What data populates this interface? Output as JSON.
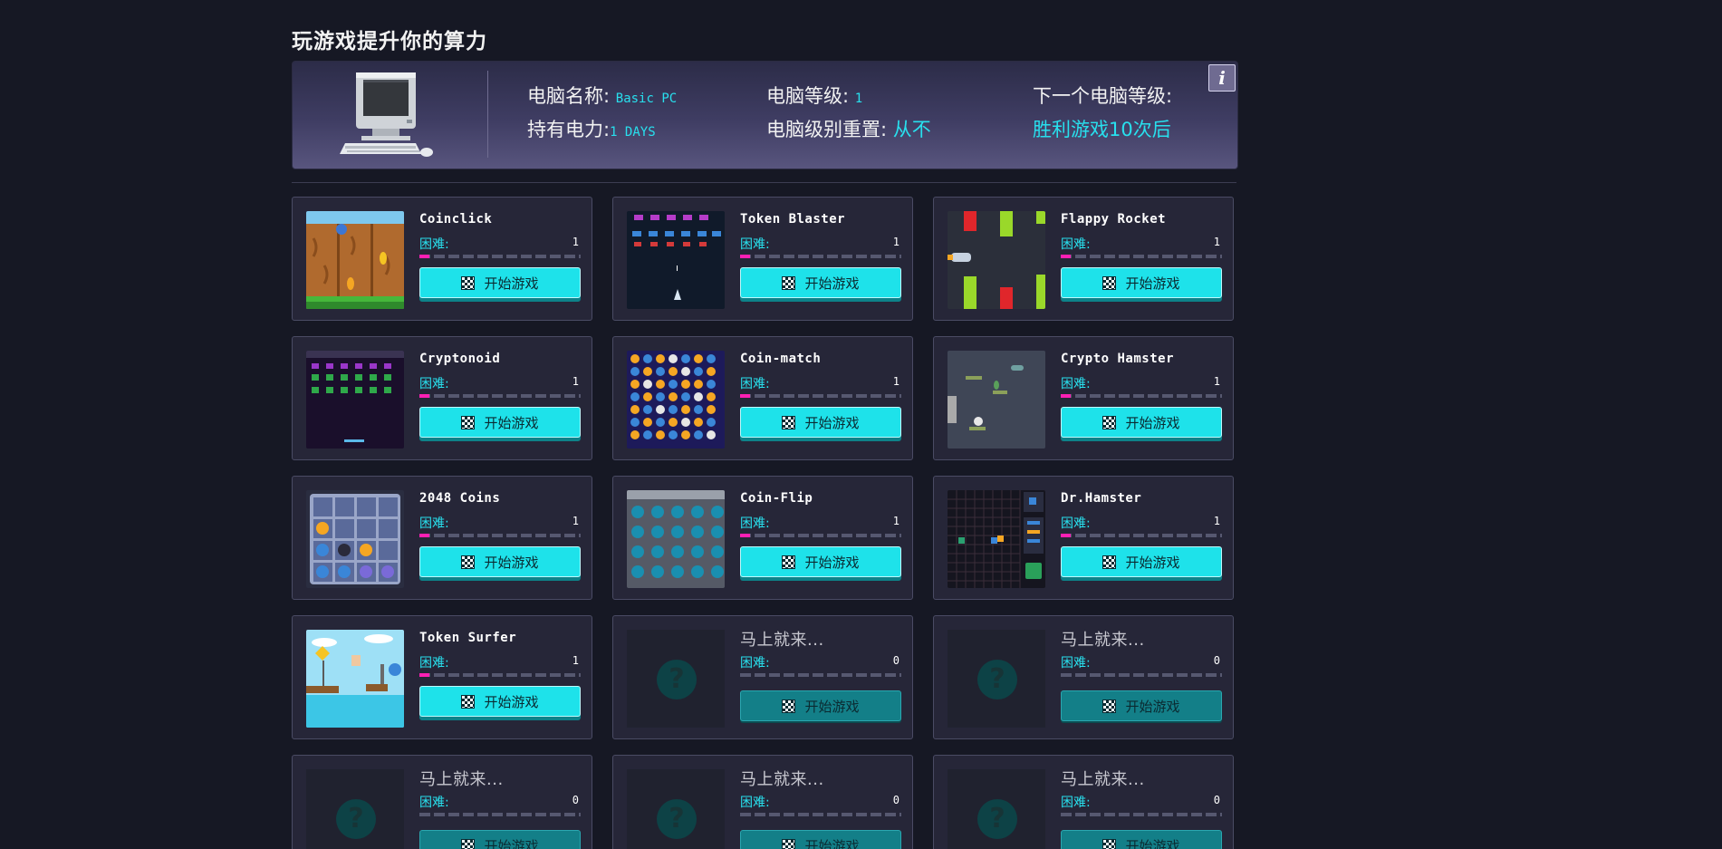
{
  "page": {
    "title": "玩游戏提升你的算力"
  },
  "pc": {
    "name_label": "电脑名称:",
    "name_value": "Basic PC",
    "power_label": "持有电力:",
    "power_value": "1 DAYS",
    "level_label": "电脑等级:",
    "level_value": "1",
    "reset_label": "电脑级别重置:",
    "reset_value": "从不",
    "next_label": "下一个电脑等级:",
    "next_value": "胜利游戏10次后",
    "info_label": "i"
  },
  "common": {
    "difficulty_label": "困难:",
    "play_label": "开始游戏",
    "coming_soon": "马上就来..."
  },
  "games": [
    {
      "title": "Coinclick",
      "difficulty": "1",
      "level": 0.06,
      "icon": "coinclick-thumb"
    },
    {
      "title": "Token Blaster",
      "difficulty": "1",
      "level": 0.06,
      "icon": "token-blaster-thumb"
    },
    {
      "title": "Flappy Rocket",
      "difficulty": "1",
      "level": 0.06,
      "icon": "flappy-rocket-thumb"
    },
    {
      "title": "Cryptonoid",
      "difficulty": "1",
      "level": 0.06,
      "icon": "cryptonoid-thumb"
    },
    {
      "title": "Coin-match",
      "difficulty": "1",
      "level": 0.06,
      "icon": "coin-match-thumb"
    },
    {
      "title": "Crypto Hamster",
      "difficulty": "1",
      "level": 0.06,
      "icon": "crypto-hamster-thumb"
    },
    {
      "title": "2048 Coins",
      "difficulty": "1",
      "level": 0.06,
      "icon": "2048-coins-thumb"
    },
    {
      "title": "Coin-Flip",
      "difficulty": "1",
      "level": 0.06,
      "icon": "coin-flip-thumb"
    },
    {
      "title": "Dr.Hamster",
      "difficulty": "1",
      "level": 0.06,
      "icon": "dr-hamster-thumb"
    },
    {
      "title": "Token Surfer",
      "difficulty": "1",
      "level": 0.06,
      "icon": "token-surfer-thumb"
    }
  ],
  "coming_soon_slots": [
    {
      "difficulty": "0"
    },
    {
      "difficulty": "0"
    },
    {
      "difficulty": "0"
    },
    {
      "difficulty": "0"
    },
    {
      "difficulty": "0"
    }
  ],
  "colors": {
    "accent": "#1ee2ea",
    "background": "#161824",
    "card": "#262638",
    "difficulty_fill": "#ff1fb4"
  }
}
